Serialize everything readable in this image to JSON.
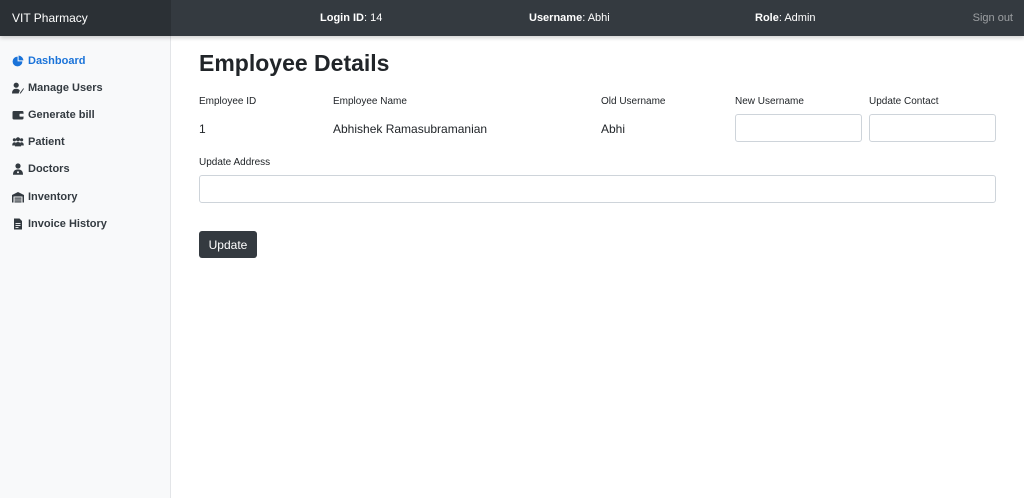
{
  "header": {
    "brand": "VIT Pharmacy",
    "login_label": "Login ID",
    "login_value": ": 14",
    "username_label": "Username",
    "username_value": ": Abhi",
    "role_label": "Role",
    "role_value": ": Admin",
    "signout": "Sign out"
  },
  "sidebar": {
    "items": [
      {
        "label": "Dashboard",
        "icon": "pie-chart-icon",
        "active": true
      },
      {
        "label": "Manage Users",
        "icon": "user-edit-icon",
        "active": false
      },
      {
        "label": "Generate bill",
        "icon": "wallet-icon",
        "active": false
      },
      {
        "label": "Patient",
        "icon": "users-icon",
        "active": false
      },
      {
        "label": "Doctors",
        "icon": "doctor-icon",
        "active": false
      },
      {
        "label": "Inventory",
        "icon": "warehouse-icon",
        "active": false
      },
      {
        "label": "Invoice History",
        "icon": "invoice-icon",
        "active": false
      }
    ]
  },
  "main": {
    "title": "Employee Details",
    "columns": {
      "employee_id": "Employee ID",
      "employee_name": "Employee Name",
      "old_username": "Old Username",
      "new_username": "New Username",
      "update_contact": "Update Contact",
      "update_address": "Update Address"
    },
    "values": {
      "employee_id": "1",
      "employee_name": "Abhishek Ramasubramanian",
      "old_username": "Abhi",
      "new_username": "",
      "update_contact": "",
      "update_address": ""
    },
    "update_button": "Update"
  },
  "colors": {
    "topbar": "#343a40",
    "brand_bg": "#2b3035",
    "sidebar_bg": "#f8f9fa",
    "active_link": "#1a73d9",
    "button": "#343a40"
  }
}
